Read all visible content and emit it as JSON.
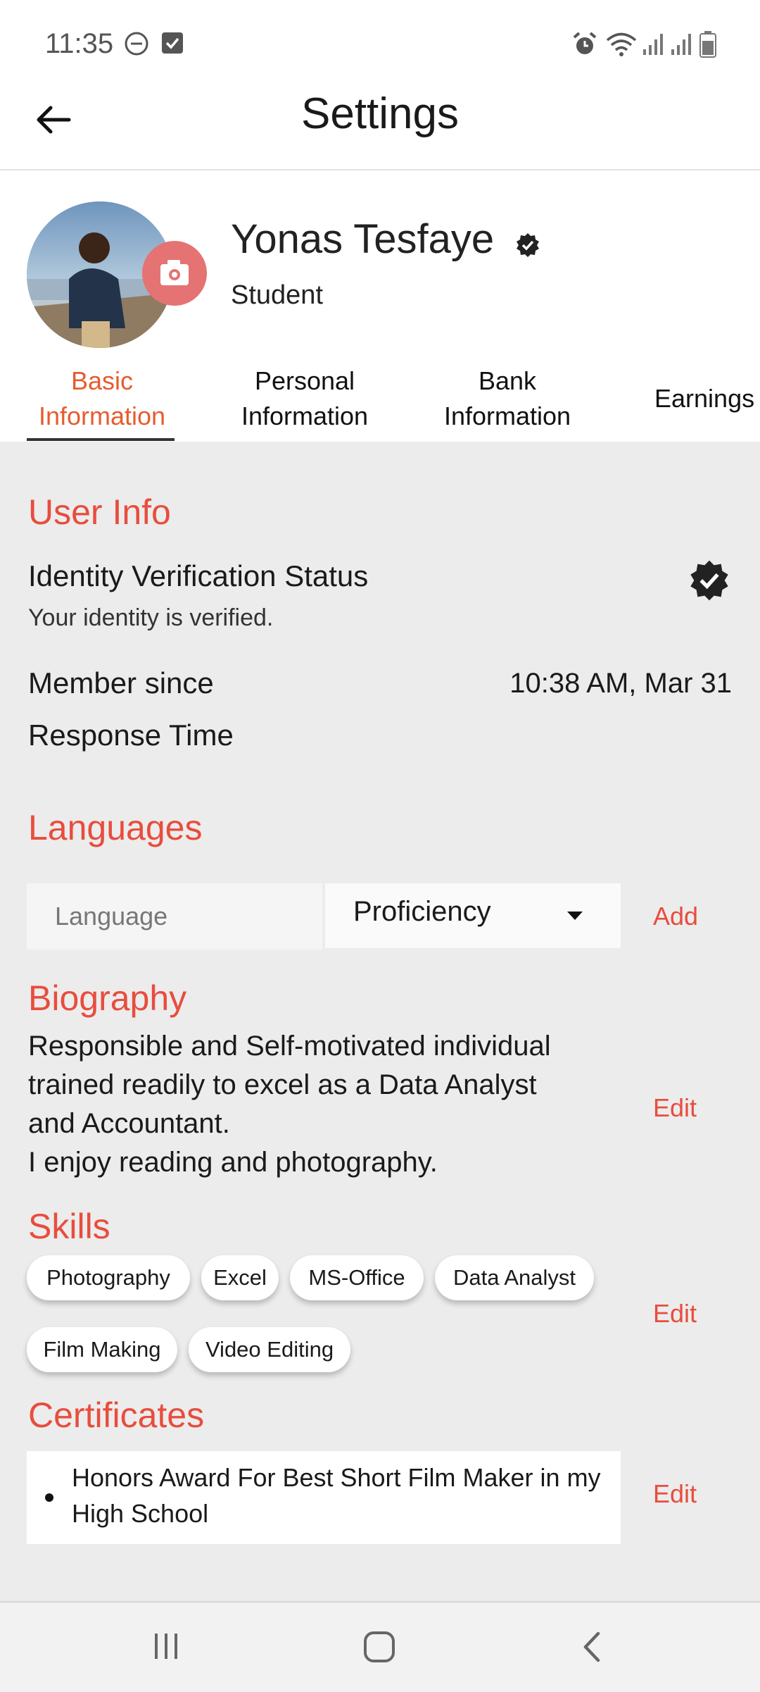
{
  "status_bar": {
    "time": "11:35"
  },
  "app_bar": {
    "title": "Settings"
  },
  "profile": {
    "name": "Yonas Tesfaye",
    "role": "Student"
  },
  "tabs": [
    {
      "label_line1": "Basic",
      "label_line2": "Information",
      "active": true
    },
    {
      "label_line1": "Personal",
      "label_line2": "Information",
      "active": false
    },
    {
      "label_line1": "Bank",
      "label_line2": "Information",
      "active": false
    },
    {
      "label_line1": "Earnings",
      "label_line2": "",
      "active": false
    }
  ],
  "user_info": {
    "heading": "User Info",
    "identity_label": "Identity Verification Status",
    "identity_status": "Your identity is verified.",
    "member_since_label": "Member since",
    "member_since_value": "10:38 AM, Mar 31",
    "response_time_label": "Response Time"
  },
  "languages": {
    "heading": "Languages",
    "language_placeholder": "Language",
    "proficiency_selected": "Proficiency",
    "add_label": "Add"
  },
  "biography": {
    "heading": "Biography",
    "lines": [
      "Responsible and Self-motivated individual",
      "trained readily to excel as a Data Analyst",
      "and Accountant.",
      "I enjoy reading and photography."
    ],
    "edit_label": "Edit"
  },
  "skills": {
    "heading": "Skills",
    "items": [
      "Photography",
      "Excel",
      "MS-Office",
      "Data Analyst",
      "Film Making",
      "Video Editing"
    ],
    "edit_label": "Edit"
  },
  "certificates": {
    "heading": "Certificates",
    "items": [
      "Honors Award For Best Short Film Maker in my High School"
    ],
    "edit_label": "Edit"
  },
  "colors": {
    "accent": "#e84d3d",
    "active_tab": "#e65c2e",
    "camera_badge": "#e57373"
  },
  "icons": [
    "dnd-icon",
    "check-box-icon",
    "alarm-icon",
    "wifi-icon",
    "signal-icon",
    "battery-icon",
    "back-arrow-icon",
    "camera-icon",
    "verified-badge-icon",
    "recent-apps-icon",
    "home-icon",
    "back-nav-icon"
  ]
}
